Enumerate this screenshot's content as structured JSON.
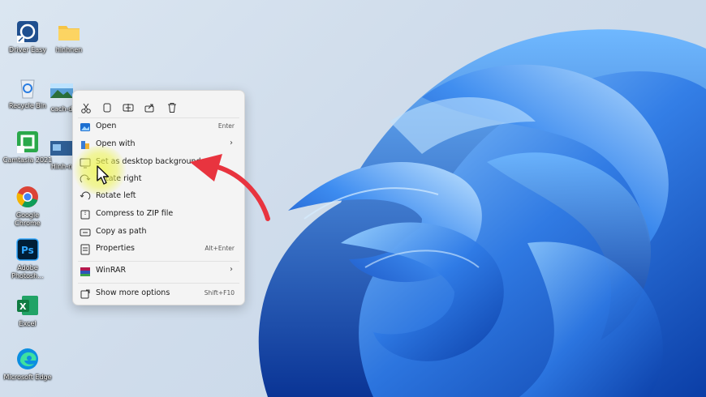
{
  "desktop": {
    "icons": [
      {
        "label": "Driver Easy"
      },
      {
        "label": "hinhnen"
      },
      {
        "label": "Recycle Bin"
      },
      {
        "label": "cach-d"
      },
      {
        "label": "Camtasia 2021"
      },
      {
        "label": "Hinh-n"
      },
      {
        "label": "Google Chrome"
      },
      {
        "label": "Adobe Photosh..."
      },
      {
        "label": "Excel"
      },
      {
        "label": "Microsoft Edge"
      }
    ]
  },
  "context_menu": {
    "toolbar": [
      "cut-icon",
      "copy-icon",
      "rename-icon",
      "share-icon",
      "delete-icon"
    ],
    "items": [
      {
        "label": "Open",
        "shortcut": "Enter",
        "icon": "photos-icon"
      },
      {
        "label": "Open with",
        "submenu": "›",
        "icon": "open-with-icon"
      },
      {
        "label": "Set as desktop background",
        "icon": "wallpaper-icon"
      },
      {
        "label": "Rotate right",
        "icon": "rotate-right-icon"
      },
      {
        "label": "Rotate left",
        "icon": "rotate-left-icon"
      },
      {
        "label": "Compress to ZIP file",
        "icon": "zip-icon"
      },
      {
        "label": "Copy as path",
        "icon": "path-icon"
      },
      {
        "label": "Properties",
        "shortcut": "Alt+Enter",
        "icon": "properties-icon"
      },
      {
        "label": "WinRAR",
        "submenu": "›",
        "icon": "winrar-icon"
      },
      {
        "label": "Show more options",
        "shortcut": "Shift+F10",
        "icon": "more-options-icon"
      }
    ]
  },
  "annotation": {
    "arrow_color": "#e8343f",
    "highlight_color": "#eef550"
  }
}
